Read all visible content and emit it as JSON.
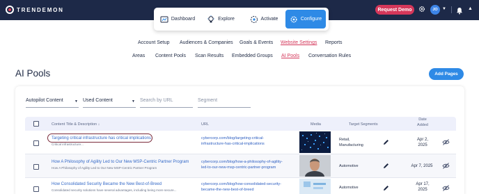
{
  "brand": {
    "logo_text": "TRENDEMON"
  },
  "header": {
    "request_demo": "Request Demo",
    "avatar_initials": "JO"
  },
  "main_nav": {
    "items": [
      {
        "label": "Dashboard",
        "icon": "dashboard-icon"
      },
      {
        "label": "Explore",
        "icon": "lightbulb-icon"
      },
      {
        "label": "Activate",
        "icon": "activate-icon"
      },
      {
        "label": "Configure",
        "icon": "configure-icon",
        "active": true
      }
    ]
  },
  "tabs": [
    "Account Setup",
    "Audiences & Companies",
    "Goals & Events",
    "Website Settings",
    "Reports"
  ],
  "subtabs": [
    "Areas",
    "Content Pools",
    "Scan Results",
    "Embedded Groups",
    "AI Pools",
    "Conversation Rules"
  ],
  "page": {
    "title": "AI Pools",
    "add_pages": "Add Pages"
  },
  "filters": {
    "autopilot": "Autopilot Content",
    "used": "Used Content",
    "search_placeholder": "Search by URL",
    "segment_placeholder": "Segment"
  },
  "table": {
    "headers": {
      "title": "Content Title & Description",
      "sort_arrow": "↓",
      "url": "URL",
      "media": "Media",
      "segments": "Target Segments",
      "date_line1": "Date",
      "date_line2": "Added"
    },
    "rows": [
      {
        "title": "Targeting critical infrastructure has critical implications",
        "description": "Critical infrastructure...",
        "url_line1": "cybercorp.com/blog/targeting-critical-",
        "url_line2": "infrastructure-has-critical-implications",
        "segments_line1": "Retail,",
        "segments_line2": "Manufacturing",
        "date_line1": "Apr 2,",
        "date_line2": "2025"
      },
      {
        "title": "How A Philosophy of Agility Led to Our New MSP-Centric Partner Program",
        "description": "How A Philosophy of Agility Led to Our New MSP-Centric Partner Program",
        "url_line1": "cybercorp.com/blog/how-a-philosophy-of-agility-",
        "url_line2": "led-to-our-new-msp-centric-partner-program",
        "segments_line1": "Automotive",
        "segments_line2": "",
        "date_line1": "Apr 7, 2025",
        "date_line2": ""
      },
      {
        "title": "How Consolidated Security Became the New Best-of-Breed",
        "description": "Consolidated security solutions have several advantages, including being more secure...",
        "url_line1": "cybercorp.com/blog/how-consolidated-security-",
        "url_line2": "became-the-new-best-of-breed",
        "segments_line1": "Automotive",
        "segments_line2": "",
        "date_line1": "Apr 17,",
        "date_line2": "2025"
      }
    ]
  },
  "colors": {
    "topbar": "#1d2948",
    "accent_blue": "#2e8ae6",
    "accent_pink": "#d4375a",
    "link_blue": "#3469c7"
  }
}
